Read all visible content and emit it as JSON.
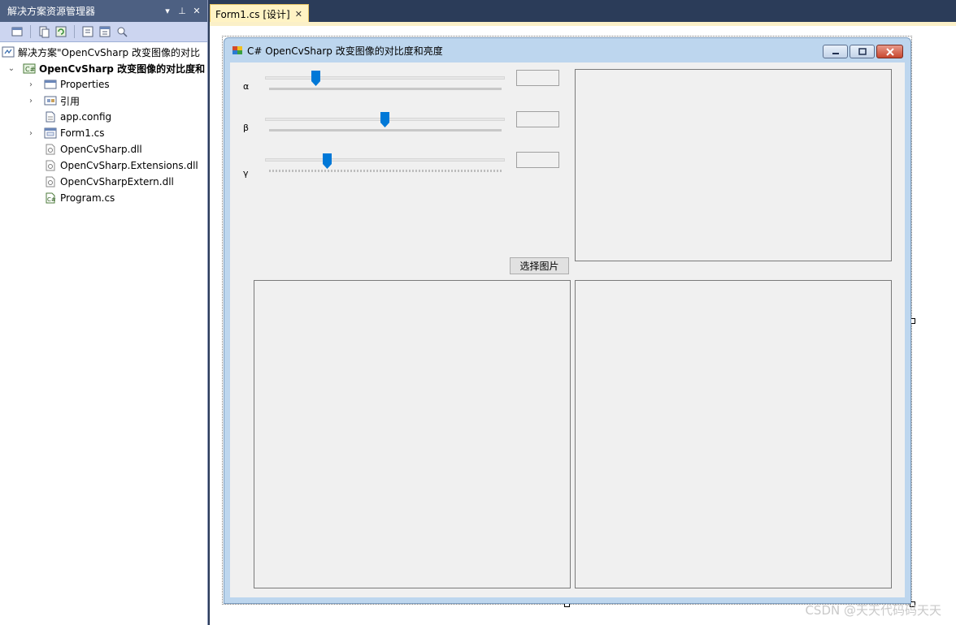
{
  "solution_explorer": {
    "title": "解决方案资源管理器",
    "title_buttons": [
      "▾",
      "⊥",
      "✕"
    ],
    "solution_label": "解决方案\"OpenCvSharp 改变图像的对比",
    "project_label": "OpenCvSharp 改变图像的对比度和",
    "items": [
      {
        "label": "Properties",
        "icon": "properties-icon",
        "expandable": true
      },
      {
        "label": "引用",
        "icon": "references-icon",
        "expandable": true
      },
      {
        "label": "app.config",
        "icon": "config-file-icon",
        "expandable": false
      },
      {
        "label": "Form1.cs",
        "icon": "form-icon",
        "expandable": true
      },
      {
        "label": "OpenCvSharp.dll",
        "icon": "dll-icon",
        "expandable": false
      },
      {
        "label": "OpenCvSharp.Extensions.dll",
        "icon": "dll-icon",
        "expandable": false
      },
      {
        "label": "OpenCvSharpExtern.dll",
        "icon": "dll-icon",
        "expandable": false
      },
      {
        "label": "Program.cs",
        "icon": "csharp-file-icon",
        "expandable": false
      }
    ]
  },
  "editor": {
    "tab_label": "Form1.cs [设计]",
    "tab_close": "✕"
  },
  "form": {
    "title": "C# OpenCvSharp 改变图像的对比度和亮度",
    "sliders": [
      {
        "label": "α",
        "value": 0.2
      },
      {
        "label": "β",
        "value": 0.5
      },
      {
        "label": "γ",
        "value": 0.25
      }
    ],
    "select_button": "选择图片"
  },
  "watermark": "CSDN @天天代码码天天",
  "colors": {
    "accent": "#0078d7",
    "tab_bg": "#fff3c4",
    "ide_bg": "#2b3c59"
  }
}
